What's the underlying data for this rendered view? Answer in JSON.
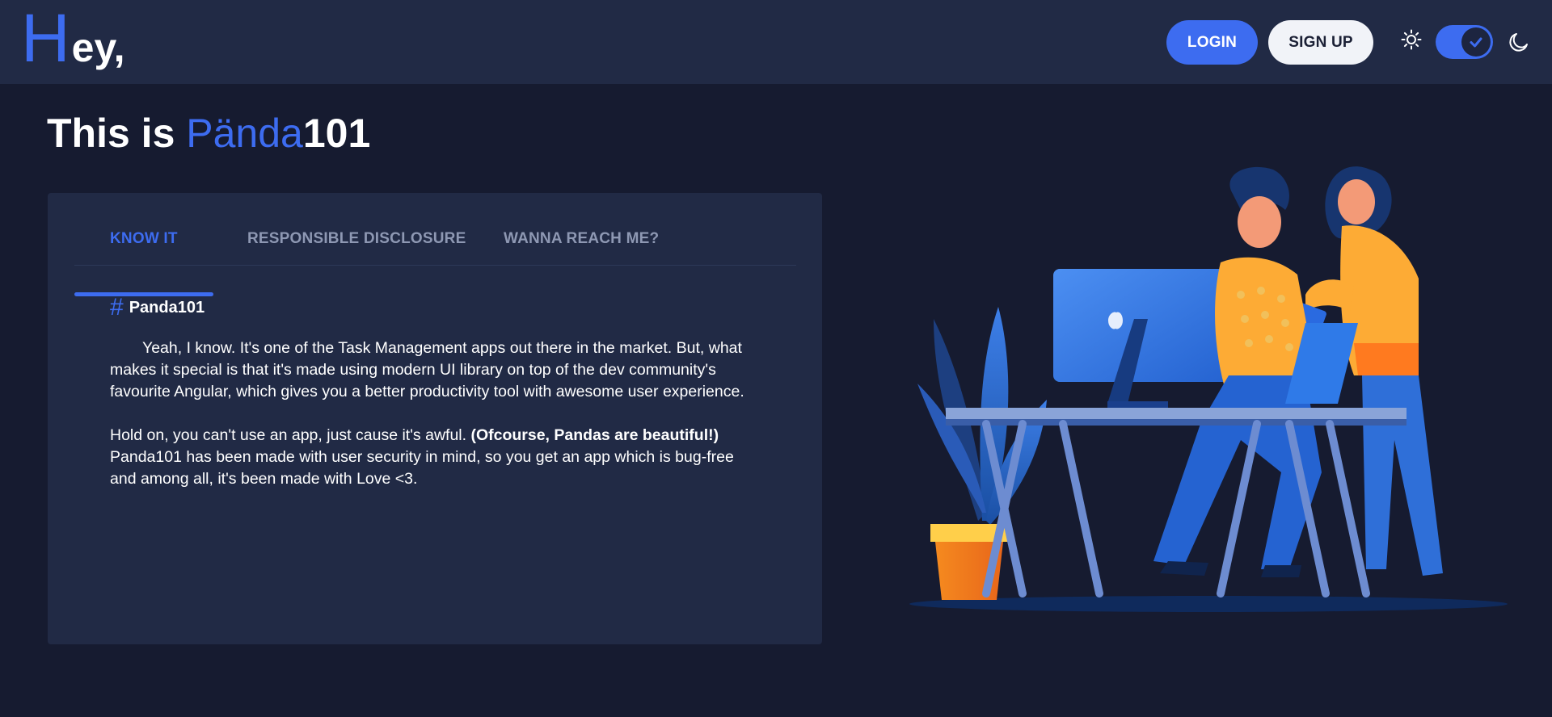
{
  "header": {
    "logo_first": "H",
    "logo_rest": "ey,",
    "login_label": "LOGIN",
    "signup_label": "SIGN UP",
    "theme_toggle_on": true
  },
  "hero": {
    "title_prefix": "This is ",
    "title_accent": "Pända",
    "title_suffix": "101"
  },
  "tabs": [
    {
      "label": "KNOW IT",
      "active": true
    },
    {
      "label": "RESPONSIBLE DISCLOSURE",
      "active": false
    },
    {
      "label": "WANNA REACH ME?",
      "active": false
    }
  ],
  "content": {
    "hash": "#",
    "heading": "Panda101",
    "paragraph1": "Yeah, I know. It's one of the Task Management apps out there in the market. But, what makes it special is that it's made using modern UI library on top of the dev community's favourite Angular, which gives you a better productivity tool with awesome user experience.",
    "paragraph2_start": "Hold on, you can't use an app, just cause it's awful. ",
    "paragraph2_bold": "(Ofcourse, Pandas are beautiful!)",
    "paragraph2_end": " Panda101 has been made with user security in mind, so you get an app which is bug-free and among all, it's been made with Love <3."
  },
  "colors": {
    "accent": "#3d6cf0",
    "background": "#161b30",
    "panel": "#212a45",
    "muted_tab": "#8e98b3"
  },
  "icons": [
    "sun-icon",
    "check-icon",
    "moon-icon"
  ]
}
